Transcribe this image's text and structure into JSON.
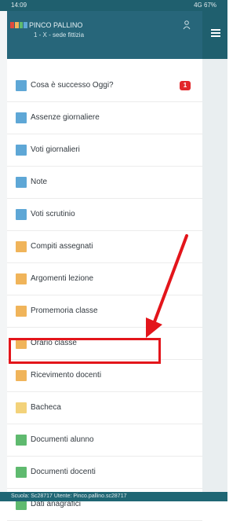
{
  "status_bar": {
    "time": "14:09",
    "right_text": "4G 67%"
  },
  "header": {
    "user_name": "PINCO PALLINO",
    "user_class": "1 - X - sede fittizia"
  },
  "menu": {
    "items": [
      {
        "label": "Cosa è successo Oggi?",
        "color": "#5ea7d6",
        "badge": "1"
      },
      {
        "label": "Assenze giornaliere",
        "color": "#5ea7d6"
      },
      {
        "label": "Voti giornalieri",
        "color": "#5ea7d6"
      },
      {
        "label": "Note",
        "color": "#5ea7d6"
      },
      {
        "label": "Voti scrutinio",
        "color": "#5ea7d6"
      },
      {
        "label": "Compiti assegnati",
        "color": "#f0b45a"
      },
      {
        "label": "Argomenti lezione",
        "color": "#f0b45a"
      },
      {
        "label": "Promemoria classe",
        "color": "#f0b45a"
      },
      {
        "label": "Orario classe",
        "color": "#f0b45a"
      },
      {
        "label": "Ricevimento docenti",
        "color": "#f0b45a"
      },
      {
        "label": "Bacheca",
        "color": "#f3d27a"
      },
      {
        "label": "Documenti alunno",
        "color": "#5fba6f"
      },
      {
        "label": "Documenti docenti",
        "color": "#5fba6f"
      },
      {
        "label": "Dati anagrafici",
        "color": "#5fba6f"
      }
    ]
  },
  "footer": {
    "text": "Scuola: Sc28717 Utente: Pinco.pallino.sc28717"
  },
  "colors": {
    "header_bg": "#27667a",
    "highlight": "#e3151b",
    "badge": "#e2262a"
  }
}
